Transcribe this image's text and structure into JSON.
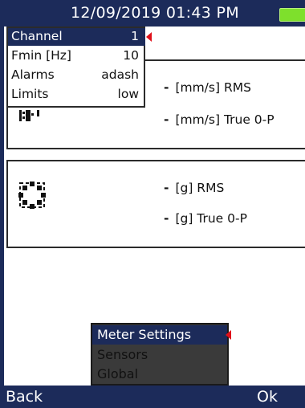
{
  "header": {
    "datetime": "12/09/2019 01:43 PM",
    "battery_color": "#7ee02c",
    "bar_color": "#1c2b5a"
  },
  "settings_menu": {
    "items": [
      {
        "label": "Channel",
        "value": "1"
      },
      {
        "label": "Fmin [Hz]",
        "value": "10"
      },
      {
        "label": "Alarms",
        "value": "adash"
      },
      {
        "label": "Limits",
        "value": "low"
      }
    ],
    "selected_index": 0,
    "marker_color": "#e0101a"
  },
  "panels": [
    {
      "icon": "vibration-sensor-icon",
      "lines": [
        {
          "dash": "-",
          "text": "[mm/s] RMS"
        },
        {
          "dash": "-",
          "text": "[mm/s] True 0-P"
        }
      ]
    },
    {
      "icon": "accelerometer-icon",
      "lines": [
        {
          "dash": "-",
          "text": "[g] RMS"
        },
        {
          "dash": "-",
          "text": "[g] True 0-P"
        }
      ]
    }
  ],
  "popup_menu": {
    "items": [
      "Meter Settings",
      "Sensors",
      "Global"
    ],
    "selected_index": 0
  },
  "footer": {
    "left": "Back",
    "right": "Ok"
  }
}
